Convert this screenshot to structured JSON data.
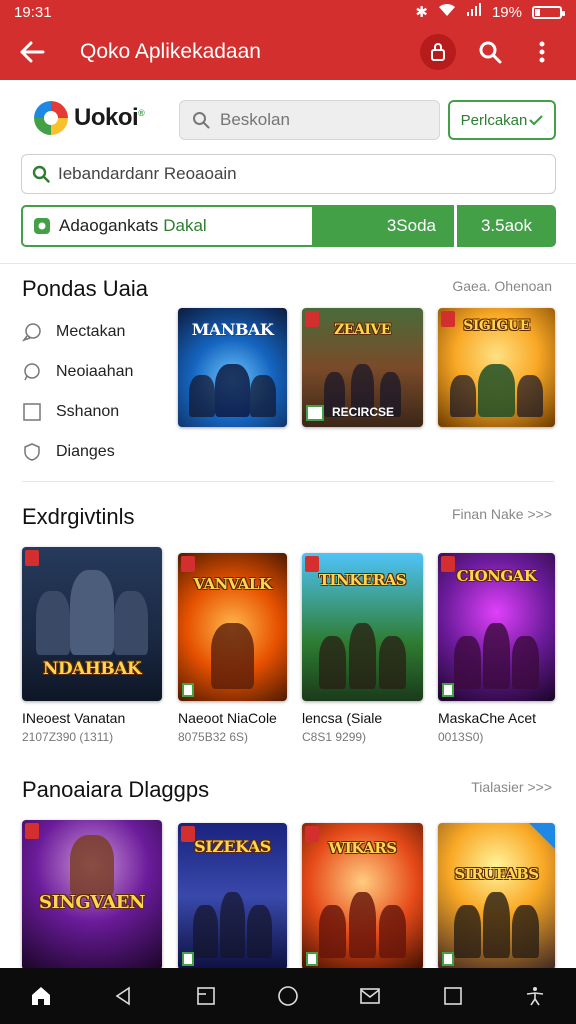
{
  "status": {
    "time": "19:31",
    "battery": "19%",
    "battery_level": 0.19
  },
  "appbar": {
    "title": "Qoko Aplikekadaan"
  },
  "header": {
    "logo_text": "Uokoi",
    "logo_sup": "®",
    "search_placeholder": "Beskolan",
    "outline_button": "Perlcakan"
  },
  "search_wide": {
    "placeholder": "Iebandardanr Reoaoain"
  },
  "promo": {
    "label": "Adaogankats",
    "accent": "Dakal",
    "fill_label": "3Soda",
    "button": "3.5aok"
  },
  "section1": {
    "title": "Pondas Uaia",
    "link": "Gaea. Ohenoan",
    "menu": [
      {
        "label": "Mectakan",
        "icon": "chat-bubble-icon"
      },
      {
        "label": "Neoiaahan",
        "icon": "speech-bubble-icon"
      },
      {
        "label": "Sshanon",
        "icon": "checkbox-icon"
      },
      {
        "label": "Dianges",
        "icon": "shield-icon"
      }
    ],
    "cards": [
      {
        "title": "MANBAK"
      },
      {
        "title": "ZEAIVE",
        "label": "RECIRCSE"
      },
      {
        "title": "SIGIGUE"
      }
    ]
  },
  "section2": {
    "title": "Exdrgivtinls",
    "link": "Finan Nake >>>",
    "cards": [
      {
        "art": "NDAHBAK",
        "caption": "INeoest Vanatan",
        "sub": "2107Z390 (1311)"
      },
      {
        "art": "VANVALK",
        "caption": "Naeoot NiaCole",
        "sub": "8075B32 6S)"
      },
      {
        "art": "TINKERAS",
        "caption": "lencsa (Siale",
        "sub": "C8S1 9299)"
      },
      {
        "art": "CIONGAK",
        "caption": "MaskaChe Acet",
        "sub": "0013S0)"
      }
    ]
  },
  "section3": {
    "title": "Panoaiara Dlaggps",
    "link": "Tialasier >>>",
    "cards": [
      {
        "art": "SINGVAEN"
      },
      {
        "art": "SIZEKAS"
      },
      {
        "art": "WIKARS"
      },
      {
        "art": "SIRUFABS"
      }
    ]
  },
  "nav": [
    "home-icon",
    "back-icon",
    "recents-icon",
    "circle-home-icon",
    "mail-icon",
    "square-icon",
    "accessibility-icon"
  ]
}
